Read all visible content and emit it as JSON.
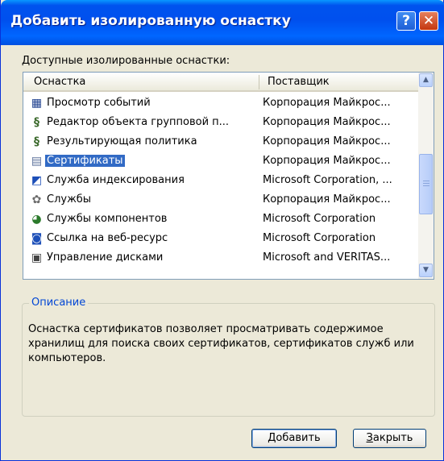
{
  "window": {
    "title": "Добавить изолированную оснастку",
    "help_glyph": "?",
    "close_glyph": "✕"
  },
  "list": {
    "label": "Доступные изолированные оснастки:",
    "columns": [
      "Оснастка",
      "Поставщик"
    ],
    "rows": [
      {
        "name": "Просмотр событий",
        "vendor": "Корпорация Майкрос...",
        "icon": "event-viewer-icon",
        "glyph": "▦",
        "selected": false
      },
      {
        "name": "Редактор объекта групповой п...",
        "vendor": "Корпорация Майкрос...",
        "icon": "group-policy-icon",
        "glyph": "§",
        "selected": false
      },
      {
        "name": "Результирующая политика",
        "vendor": "Корпорация Майкрос...",
        "icon": "resultant-policy-icon",
        "glyph": "§",
        "selected": false
      },
      {
        "name": "Сертификаты",
        "vendor": "Корпорация Майкрос...",
        "icon": "certificates-icon",
        "glyph": "▤",
        "selected": true
      },
      {
        "name": "Служба индексирования",
        "vendor": "Microsoft Corporation, ...",
        "icon": "indexing-service-icon",
        "glyph": "◩",
        "selected": false
      },
      {
        "name": "Службы",
        "vendor": "Корпорация Майкрос...",
        "icon": "services-icon",
        "glyph": "✿",
        "selected": false
      },
      {
        "name": "Службы компонентов",
        "vendor": "Microsoft Corporation",
        "icon": "component-services-icon",
        "glyph": "◕",
        "selected": false
      },
      {
        "name": "Ссылка на веб-ресурс",
        "vendor": "Microsoft Corporation",
        "icon": "web-link-icon",
        "glyph": "◙",
        "selected": false
      },
      {
        "name": "Управление дисками",
        "vendor": "Microsoft and VERITAS...",
        "icon": "disk-management-icon",
        "glyph": "▣",
        "selected": false
      }
    ],
    "scroll_up_glyph": "▲",
    "scroll_down_glyph": "▼"
  },
  "description": {
    "title": "Описание",
    "text": "Оснастка сертификатов позволяет просматривать содержимое хранилищ для поиска своих сертификатов, сертификатов служб или компьютеров."
  },
  "buttons": {
    "add_label_key": "Д",
    "add_label_rest": "обавить",
    "close_label_key": "З",
    "close_label_rest": "акрыть"
  }
}
